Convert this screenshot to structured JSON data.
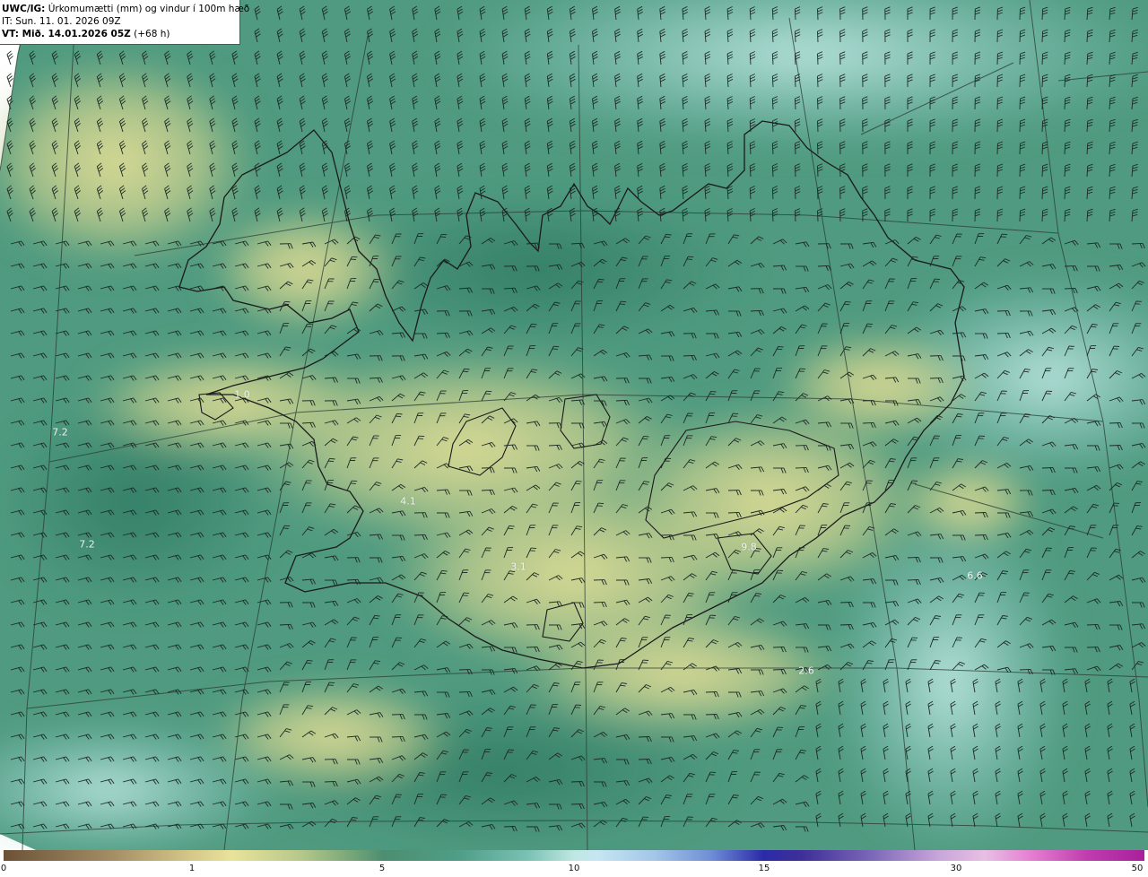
{
  "header": {
    "model_label": "UWC/IG:",
    "parameter": "Úrkomumætti (mm) og vindur í 100m hæð",
    "init_time": "IT: Sun. 11. 01. 2026 09Z",
    "valid_label": "VT: Mið. 14.01.2026 05Z",
    "lead": "(+68 h)"
  },
  "map_labels": [
    {
      "id": "label-1",
      "text": "1.0"
    },
    {
      "id": "label-2",
      "text": "7.2"
    },
    {
      "id": "label-3",
      "text": "7.2"
    },
    {
      "id": "label-4",
      "text": "4.1"
    },
    {
      "id": "label-5",
      "text": "3.1"
    },
    {
      "id": "label-6",
      "text": "6.6"
    },
    {
      "id": "label-7",
      "text": "2.6"
    },
    {
      "id": "label-8",
      "text": "9.8"
    }
  ],
  "colorbar": {
    "ticks": [
      "0",
      "1",
      "5",
      "10",
      "15",
      "30",
      "50"
    ],
    "unit": "mm"
  },
  "colors": {
    "low_dry": "#e9e39a",
    "mid": "#4c8e70",
    "high": "#bfe7e2",
    "coastline": "#1a1a1a",
    "wind_barb": "#1e2a25"
  }
}
